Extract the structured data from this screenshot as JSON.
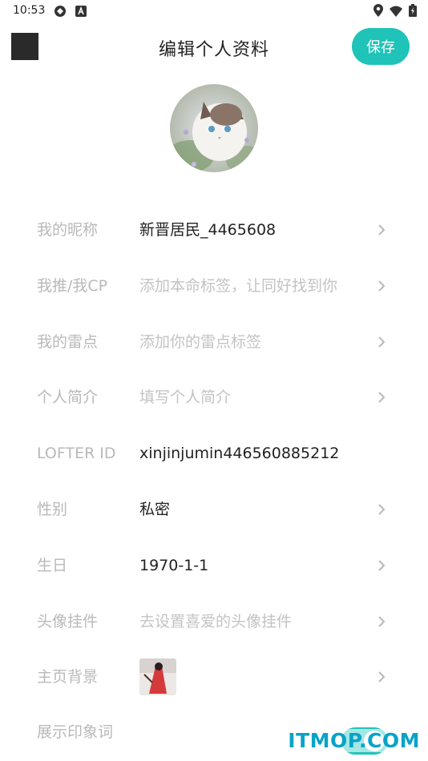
{
  "status_bar": {
    "time": "10:53"
  },
  "header": {
    "title": "编辑个人资料",
    "save_label": "保存"
  },
  "rows": [
    {
      "label": "我的昵称",
      "value": "新晋居民_4465608",
      "placeholder": false
    },
    {
      "label": "我推/我CP",
      "value": "添加本命标签，让同好找到你",
      "placeholder": true
    },
    {
      "label": "我的雷点",
      "value": "添加你的雷点标签",
      "placeholder": true
    },
    {
      "label": "个人简介",
      "value": "填写个人简介",
      "placeholder": true
    },
    {
      "label": "LOFTER ID",
      "value": "xinjinjumin446560885212",
      "placeholder": false
    },
    {
      "label": "性别",
      "value": "私密",
      "placeholder": false
    },
    {
      "label": "生日",
      "value": "1970-1-1",
      "placeholder": false
    },
    {
      "label": "头像挂件",
      "value": "去设置喜爱的头像挂件",
      "placeholder": true
    },
    {
      "label": "主页背景",
      "value": "",
      "placeholder": false
    },
    {
      "label": "展示印象词",
      "value": "",
      "placeholder": false
    }
  ],
  "impression_toggle_on": true,
  "watermark": "ITMOP.COM",
  "colors": {
    "accent": "#1fc3b8",
    "label": "#b9b9b9",
    "text": "#222222"
  }
}
